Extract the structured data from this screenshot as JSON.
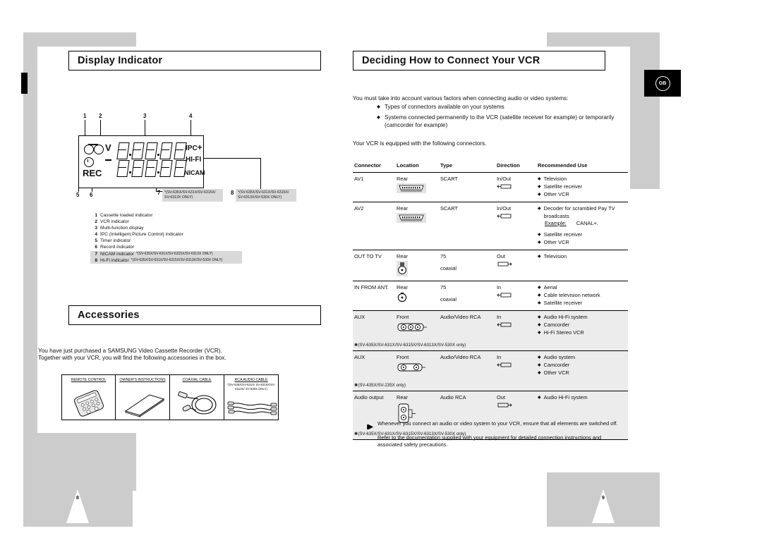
{
  "page": {
    "left_page_number": "8",
    "right_page_number": "9",
    "region_badge": "GB"
  },
  "left": {
    "section1_title": "Display Indicator",
    "section2_title": "Accessories",
    "callouts": [
      "1",
      "2",
      "3",
      "4",
      "5",
      "6",
      "7",
      "8"
    ],
    "lcd": {
      "v_label": "V",
      "rec_label": "REC",
      "ipc_label": "IPC",
      "ipc_plus": "+",
      "hifi_label": "HI-FI",
      "nicam_label": "NICAM"
    },
    "model_box_7": "(SV-635X/SV-631X/SV-6315X/ SV-6313X ONLY)",
    "model_box_8": "(SV-635X/SV-631X/SV-6315X/ SV-6313X/SV-530X ONLY)",
    "legend": [
      {
        "n": "1",
        "text": "Cassette loaded indicator",
        "note": "",
        "highlight": false
      },
      {
        "n": "2",
        "text": "VCR indicator",
        "note": "",
        "highlight": false
      },
      {
        "n": "3",
        "text": "Multi-function display",
        "note": "",
        "highlight": false
      },
      {
        "n": "4",
        "text": "IPC (Intelligent Picture Control) indicator",
        "note": "",
        "highlight": false
      },
      {
        "n": "5",
        "text": "Timer indicator",
        "note": "",
        "highlight": false
      },
      {
        "n": "6",
        "text": "Record indicator",
        "note": "",
        "highlight": false
      },
      {
        "n": "7",
        "text": "NICAM indicator",
        "note": "*(SV-635X/SV-631X/SV-6315X/SV-6313X ONLY)",
        "highlight": true
      },
      {
        "n": "8",
        "text": "Hi-Fi indicator",
        "note": "*(SV-635X/SV-631X/SV-6315X/SV-6313X/SV-530X ONLY)",
        "highlight": true
      }
    ],
    "accessories_intro_line1": "You have just purchased a SAMSUNG Video Cassette Recorder (VCR).",
    "accessories_intro_line2": "Together with your VCR, you will find the following accessories in the box.",
    "accessories": [
      {
        "caption": "REMOTE CONTROL",
        "sub": "",
        "icon": "remote-control-icon"
      },
      {
        "caption": "OWNER'S INSTRUCTIONS",
        "sub": "",
        "icon": "manual-book-icon"
      },
      {
        "caption": "COAXIAL CABLE",
        "sub": "",
        "icon": "coaxial-cable-icon"
      },
      {
        "caption": "RCA AUDIO CABLE",
        "sub": "*(SV-635X/SV-631X/ SV-6315X/SV-6313X/ SV-530X ONLY)",
        "icon": "rca-audio-cable-icon"
      }
    ]
  },
  "right": {
    "section_title": "Deciding How to Connect Your VCR",
    "intro": "You must take into account various factors when connecting audio or video systems:",
    "bullets": [
      "Types of connectors available on your systems",
      "Systems connected permanently to the VCR (satellite receiver for example) or temporarily (camcorder for example)"
    ],
    "equipped_line": "Your VCR is equipped with the following connectors.",
    "table": {
      "headers": [
        "Connector",
        "Location",
        "Type",
        "Direction",
        "Recommended Use"
      ],
      "rows": [
        {
          "connector": "AV1",
          "location": "Rear",
          "connector_icon": "scart-socket-icon",
          "type": "SCART",
          "type2": "",
          "direction": "In/Out",
          "direction_icon": "in-out-arrow-icon",
          "uses": [
            "Television",
            "Satellite receiver",
            "Other VCR"
          ],
          "extra": "",
          "example_label": "",
          "example_value": "",
          "model_note": "",
          "shade": false
        },
        {
          "connector": "AV2",
          "location": "Rear",
          "connector_icon": "scart-socket-icon",
          "type": "SCART",
          "type2": "",
          "direction": "In/Out",
          "direction_icon": "in-out-arrow-icon",
          "uses": [
            "Decoder for scrambled Pay TV broadcasts",
            "Satellite receiver",
            "Other VCR"
          ],
          "extra": "",
          "example_label": "Example:",
          "example_value": "CANAL+.",
          "model_note": "",
          "shade": false
        },
        {
          "connector": "OUT TO TV",
          "location": "Rear",
          "connector_icon": "coaxial-socket-icon",
          "type": "75",
          "type2": "coaxial",
          "direction": "Out",
          "direction_icon": "out-arrow-icon",
          "uses": [
            "Television"
          ],
          "extra": "",
          "example_label": "",
          "example_value": "",
          "model_note": "",
          "shade": false
        },
        {
          "connector": "IN FROM ANT.",
          "location": "Rear",
          "connector_icon": "coaxial-socket-icon",
          "type": "75",
          "type2": "coaxial",
          "direction": "In",
          "direction_icon": "in-arrow-icon",
          "uses": [
            "Aerial",
            "Cable television network",
            "Satellite receiver"
          ],
          "extra": "",
          "example_label": "",
          "example_value": "",
          "model_note": "",
          "shade": false
        },
        {
          "connector": "AUX",
          "location": "Front",
          "connector_icon": "rca-triple-jack-icon",
          "type": "Audio/Video RCA",
          "type2": "",
          "direction": "In",
          "direction_icon": "in-arrow-icon",
          "uses": [
            "Audio Hi-Fi system",
            "Camcorder",
            "Hi-Fi Stereo VCR"
          ],
          "extra": "",
          "example_label": "",
          "example_value": "",
          "model_note": "(SV-635X/SV-631X/SV-6315X/SV-6313X/SV-530X only)",
          "shade": true
        },
        {
          "connector": "AUX",
          "location": "Front",
          "connector_icon": "rca-dual-jack-icon",
          "type": "Audio/Video RCA",
          "type2": "",
          "direction": "In",
          "direction_icon": "in-arrow-icon",
          "uses": [
            "Audio system",
            "Camcorder",
            "Other VCR"
          ],
          "extra": "",
          "example_label": "",
          "example_value": "",
          "model_note": "(SV-435X/SV-235X only)",
          "shade": true
        },
        {
          "connector": "Audio output",
          "location": "Rear",
          "connector_icon": "rca-audio-out-icon",
          "type": "Audio RCA",
          "type2": "",
          "direction": "Out",
          "direction_icon": "out-arrow-icon",
          "uses": [
            "Audio Hi-Fi system"
          ],
          "extra": "",
          "example_label": "",
          "example_value": "",
          "model_note": "(SV-635X/SV-631X/SV-6315X/SV-6313X/SV-530X only)",
          "shade": true
        }
      ]
    },
    "footer_note_1": "Whenever you connect an audio or video system to your VCR, ensure that all elements are switched off.",
    "footer_note_2": "Refer to the documentation supplied with your equipment for detailed connection instructions and associated safety precautions."
  }
}
